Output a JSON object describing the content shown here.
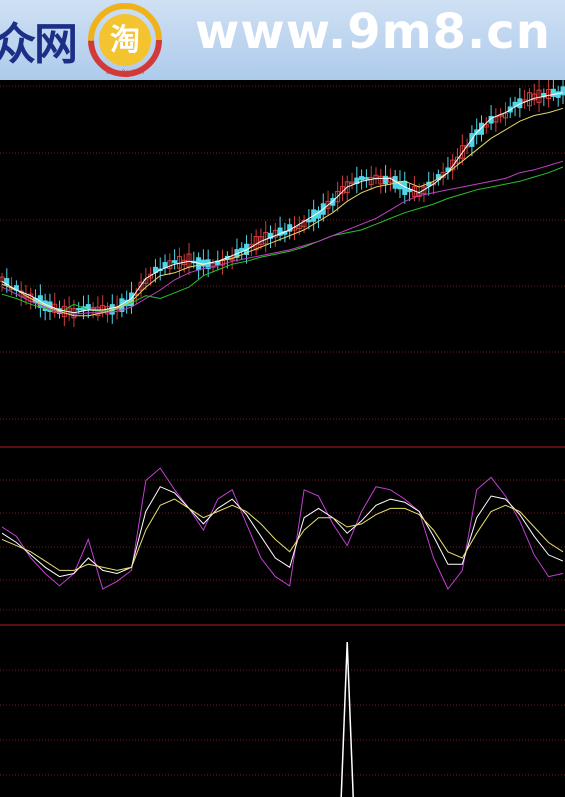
{
  "banner": {
    "left_text": "众网",
    "site_text": "www.9m8.cn",
    "logo_glyph": "淘",
    "logo_sub": "www.9m8.cn"
  },
  "colors": {
    "background": "#000000",
    "grid": "#7a1818",
    "panel_border": "#b02020",
    "candle_up": "#d23c3c",
    "candle_down": "#4fd6e8",
    "ma_white": "#ffffff",
    "ma_yellow": "#e6d56a",
    "ma_magenta": "#c040c0",
    "ma_green": "#27c227",
    "osc_magenta": "#c040d0",
    "osc_white": "#ffffff",
    "osc_yellow": "#e8e070"
  },
  "chart_data": {
    "type": "line",
    "panels": [
      {
        "name": "price",
        "chart_type": "candlestick",
        "series": [
          {
            "values": [
              225,
              222,
              218,
              215,
              212,
              218,
              214,
              213,
              216,
              219,
              224,
              222,
              226,
              230,
              238,
              242,
              246,
              248,
              251,
              253,
              255,
              258,
              262,
              266,
              268,
              270,
              274,
              278,
              282,
              285,
              288,
              292,
              295,
              298,
              300,
              302,
              304,
              307,
              310,
              314
            ]
          },
          {
            "values": [
              230,
              225,
              220,
              216,
              212,
              211,
              212,
              212,
              213,
              216,
              222,
              228,
              235,
              240,
              243,
              245,
              248,
              250,
              252,
              254,
              256,
              259,
              262,
              266,
              270,
              274,
              278,
              284,
              290,
              294,
              296,
              298,
              300,
              302,
              304,
              306,
              310,
              312,
              315,
              318
            ]
          },
          {
            "values": [
              232,
              228,
              222,
              217,
              213,
              210,
              210,
              212,
              215,
              220,
              230,
              238,
              240,
              244,
              246,
              248,
              250,
              254,
              258,
              262,
              266,
              270,
              276,
              282,
              290,
              296,
              300,
              302,
              304,
              300,
              304,
              310,
              318,
              326,
              334,
              340,
              346,
              350,
              352,
              355
            ]
          },
          {
            "values": [
              234,
              228,
              224,
              218,
              214,
              212,
              214,
              214,
              216,
              222,
              236,
              242,
              246,
              248,
              246,
              248,
              252,
              256,
              262,
              266,
              270,
              276,
              282,
              290,
              300,
              304,
              306,
              306,
              300,
              296,
              302,
              310,
              324,
              338,
              348,
              352,
              358,
              362,
              364,
              366
            ]
          }
        ]
      },
      {
        "name": "oscillator",
        "chart_type": "line",
        "series": [
          {
            "values": [
              60,
              54,
              40,
              30,
              22,
              30,
              52,
              20,
              25,
              32,
              90,
              98,
              84,
              72,
              58,
              78,
              84,
              62,
              40,
              28,
              22,
              84,
              80,
              62,
              48,
              70,
              86,
              84,
              78,
              70,
              40,
              20,
              32,
              84,
              92,
              80,
              64,
              42,
              28,
              30
            ]
          },
          {
            "values": [
              56,
              50,
              42,
              34,
              28,
              30,
              40,
              32,
              30,
              34,
              70,
              86,
              82,
              72,
              62,
              72,
              78,
              68,
              54,
              40,
              34,
              66,
              72,
              66,
              56,
              64,
              74,
              78,
              76,
              70,
              54,
              36,
              36,
              66,
              80,
              78,
              68,
              54,
              42,
              38
            ]
          },
          {
            "values": [
              52,
              48,
              44,
              38,
              32,
              32,
              36,
              34,
              32,
              34,
              58,
              74,
              78,
              72,
              66,
              70,
              74,
              70,
              62,
              52,
              44,
              58,
              66,
              66,
              60,
              62,
              68,
              72,
              72,
              68,
              58,
              44,
              40,
              56,
              70,
              74,
              70,
              60,
              50,
              44
            ]
          }
        ]
      },
      {
        "name": "volume-spike",
        "chart_type": "line",
        "series": [
          {
            "values": [
              0,
              0,
              0,
              0,
              0,
              0,
              0,
              0,
              0,
              0,
              0,
              0,
              0,
              0,
              0,
              0,
              0,
              0,
              0,
              0,
              0,
              0,
              0,
              0,
              100,
              0,
              0,
              0,
              0,
              0,
              0,
              0,
              0,
              0,
              0,
              0,
              0,
              0,
              0,
              0
            ]
          }
        ]
      }
    ]
  }
}
